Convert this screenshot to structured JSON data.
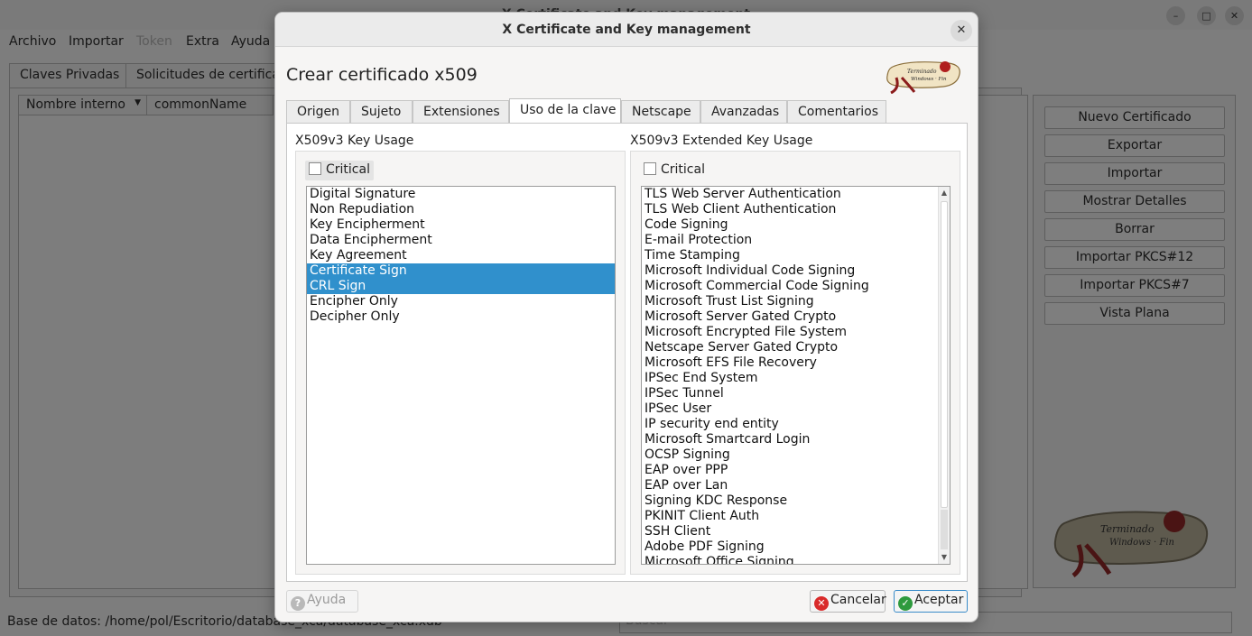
{
  "main": {
    "title": "X Certificate and Key management",
    "window_buttons": [
      "–",
      "□",
      "✕"
    ],
    "menu": [
      "Archivo",
      "Importar",
      "Token",
      "Extra",
      "Ayuda"
    ],
    "tabs": [
      "Claves Privadas",
      "Solicitudes de certificación"
    ],
    "columns": [
      "Nombre interno",
      "commonName"
    ],
    "buttons": [
      "Nuevo Certificado",
      "Exportar",
      "Importar",
      "Mostrar Detalles",
      "Borrar",
      "Importar PKCS#12",
      "Importar PKCS#7",
      "Vista Plana"
    ],
    "status": "Base de datos: /home/pol/Escritorio/database_xca/database_xca.xdb",
    "search_placeholder": "Buscar"
  },
  "dialog": {
    "title": "X Certificate and Key management",
    "heading": "Crear certificado x509",
    "tabs": [
      "Origen",
      "Sujeto",
      "Extensiones",
      "Uso de la clave",
      "Netscape",
      "Avanzadas",
      "Comentarios"
    ],
    "active_tab": "Uso de la clave",
    "key_usage": {
      "title": "X509v3 Key Usage",
      "critical_label": "Critical",
      "critical_checked": false,
      "items": [
        "Digital Signature",
        "Non Repudiation",
        "Key Encipherment",
        "Data Encipherment",
        "Key Agreement",
        "Certificate Sign",
        "CRL Sign",
        "Encipher Only",
        "Decipher Only"
      ],
      "selected": [
        "Certificate Sign",
        "CRL Sign"
      ]
    },
    "extended_key_usage": {
      "title": "X509v3 Extended Key Usage",
      "critical_label": "Critical",
      "critical_checked": false,
      "items": [
        "TLS Web Server Authentication",
        "TLS Web Client Authentication",
        "Code Signing",
        "E-mail Protection",
        "Time Stamping",
        "Microsoft Individual Code Signing",
        "Microsoft Commercial Code Signing",
        "Microsoft Trust List Signing",
        "Microsoft Server Gated Crypto",
        "Microsoft Encrypted File System",
        "Netscape Server Gated Crypto",
        "Microsoft EFS File Recovery",
        "IPSec End System",
        "IPSec Tunnel",
        "IPSec User",
        "IP security end entity",
        "Microsoft Smartcard Login",
        "OCSP Signing",
        "EAP over PPP",
        "EAP over Lan",
        "Signing KDC Response",
        "PKINIT Client Auth",
        "SSH Client",
        "Adobe PDF Signing",
        "Microsoft Office Signing"
      ]
    },
    "help_button": "Ayuda",
    "cancel_button": "Cancelar",
    "accept_button": "Aceptar"
  },
  "colors": {
    "selection": "#3090cc",
    "cancel_icon": "#d92b2b",
    "accept_icon": "#2e9a3e"
  }
}
